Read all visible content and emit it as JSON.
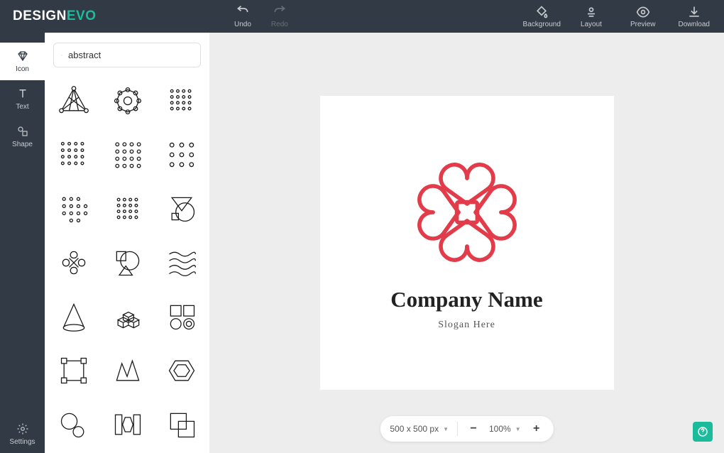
{
  "brand": {
    "part1": "DESIGN",
    "part2": "EVO"
  },
  "toolbar": {
    "undo": "Undo",
    "redo": "Redo",
    "background": "Background",
    "layout": "Layout",
    "preview": "Preview",
    "download": "Download"
  },
  "rail": {
    "icon": "Icon",
    "text": "Text",
    "shape": "Shape",
    "settings": "Settings"
  },
  "search": {
    "value": "abstract"
  },
  "icons": [
    "triangle-mesh",
    "star-lattice",
    "dot-matrix-1",
    "dot-matrix-2",
    "dot-matrix-3",
    "dot-matrix-4",
    "dot-matrix-5",
    "dot-matrix-6",
    "geo-compound",
    "knot-outline",
    "circle-shapes",
    "waves",
    "cone",
    "cubes-stack",
    "squares-circles",
    "crop-frame",
    "zigzag-bolt",
    "hexagon-nest",
    "circles-pair",
    "rect-hex-rect",
    "squares-overlap"
  ],
  "canvas": {
    "company": "Company Name",
    "slogan": "Slogan Here"
  },
  "zoom": {
    "dimensions": "500 x 500 px",
    "percent": "100%"
  },
  "colors": {
    "accent": "#e23b4a"
  }
}
